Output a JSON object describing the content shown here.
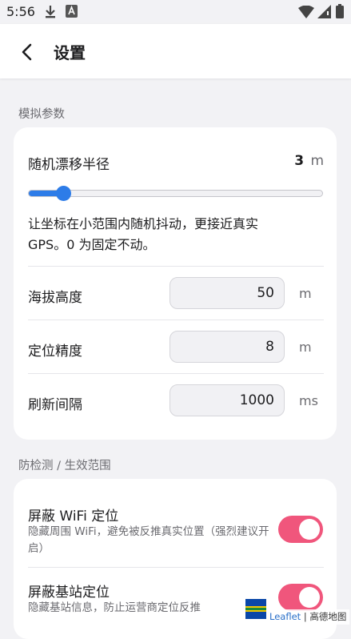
{
  "status_bar": {
    "time": "5:56"
  },
  "app_bar": {
    "title": "设置"
  },
  "sections": {
    "sim": "模拟参数",
    "detect": "防检测 / 生效范围"
  },
  "drift": {
    "label": "随机漂移半径",
    "value": "3",
    "unit": "m",
    "slider_fraction": 0.12,
    "description": "让坐标在小范围内随机抖动，更接近真实 GPS。0 为固定不动。"
  },
  "altitude": {
    "label": "海拔高度",
    "value": "50",
    "unit": "m"
  },
  "accuracy": {
    "label": "定位精度",
    "value": "8",
    "unit": "m"
  },
  "refresh": {
    "label": "刷新间隔",
    "value": "1000",
    "unit": "ms"
  },
  "wifi": {
    "label": "屏蔽 WiFi 定位",
    "description": "隐藏周围 WiFi，避免被反推真实位置（强烈建议开启）",
    "enabled": true
  },
  "cell": {
    "label": "屏蔽基站定位",
    "description": "隐藏基站信息，防止运营商定位反推",
    "enabled": true
  },
  "attribution": {
    "leaflet": "Leaflet",
    "separator": "|",
    "map": "高德地图"
  },
  "colors": {
    "accent": "#2d7ce8",
    "toggle_on": "#f0567c",
    "background": "#f2f2f5"
  }
}
